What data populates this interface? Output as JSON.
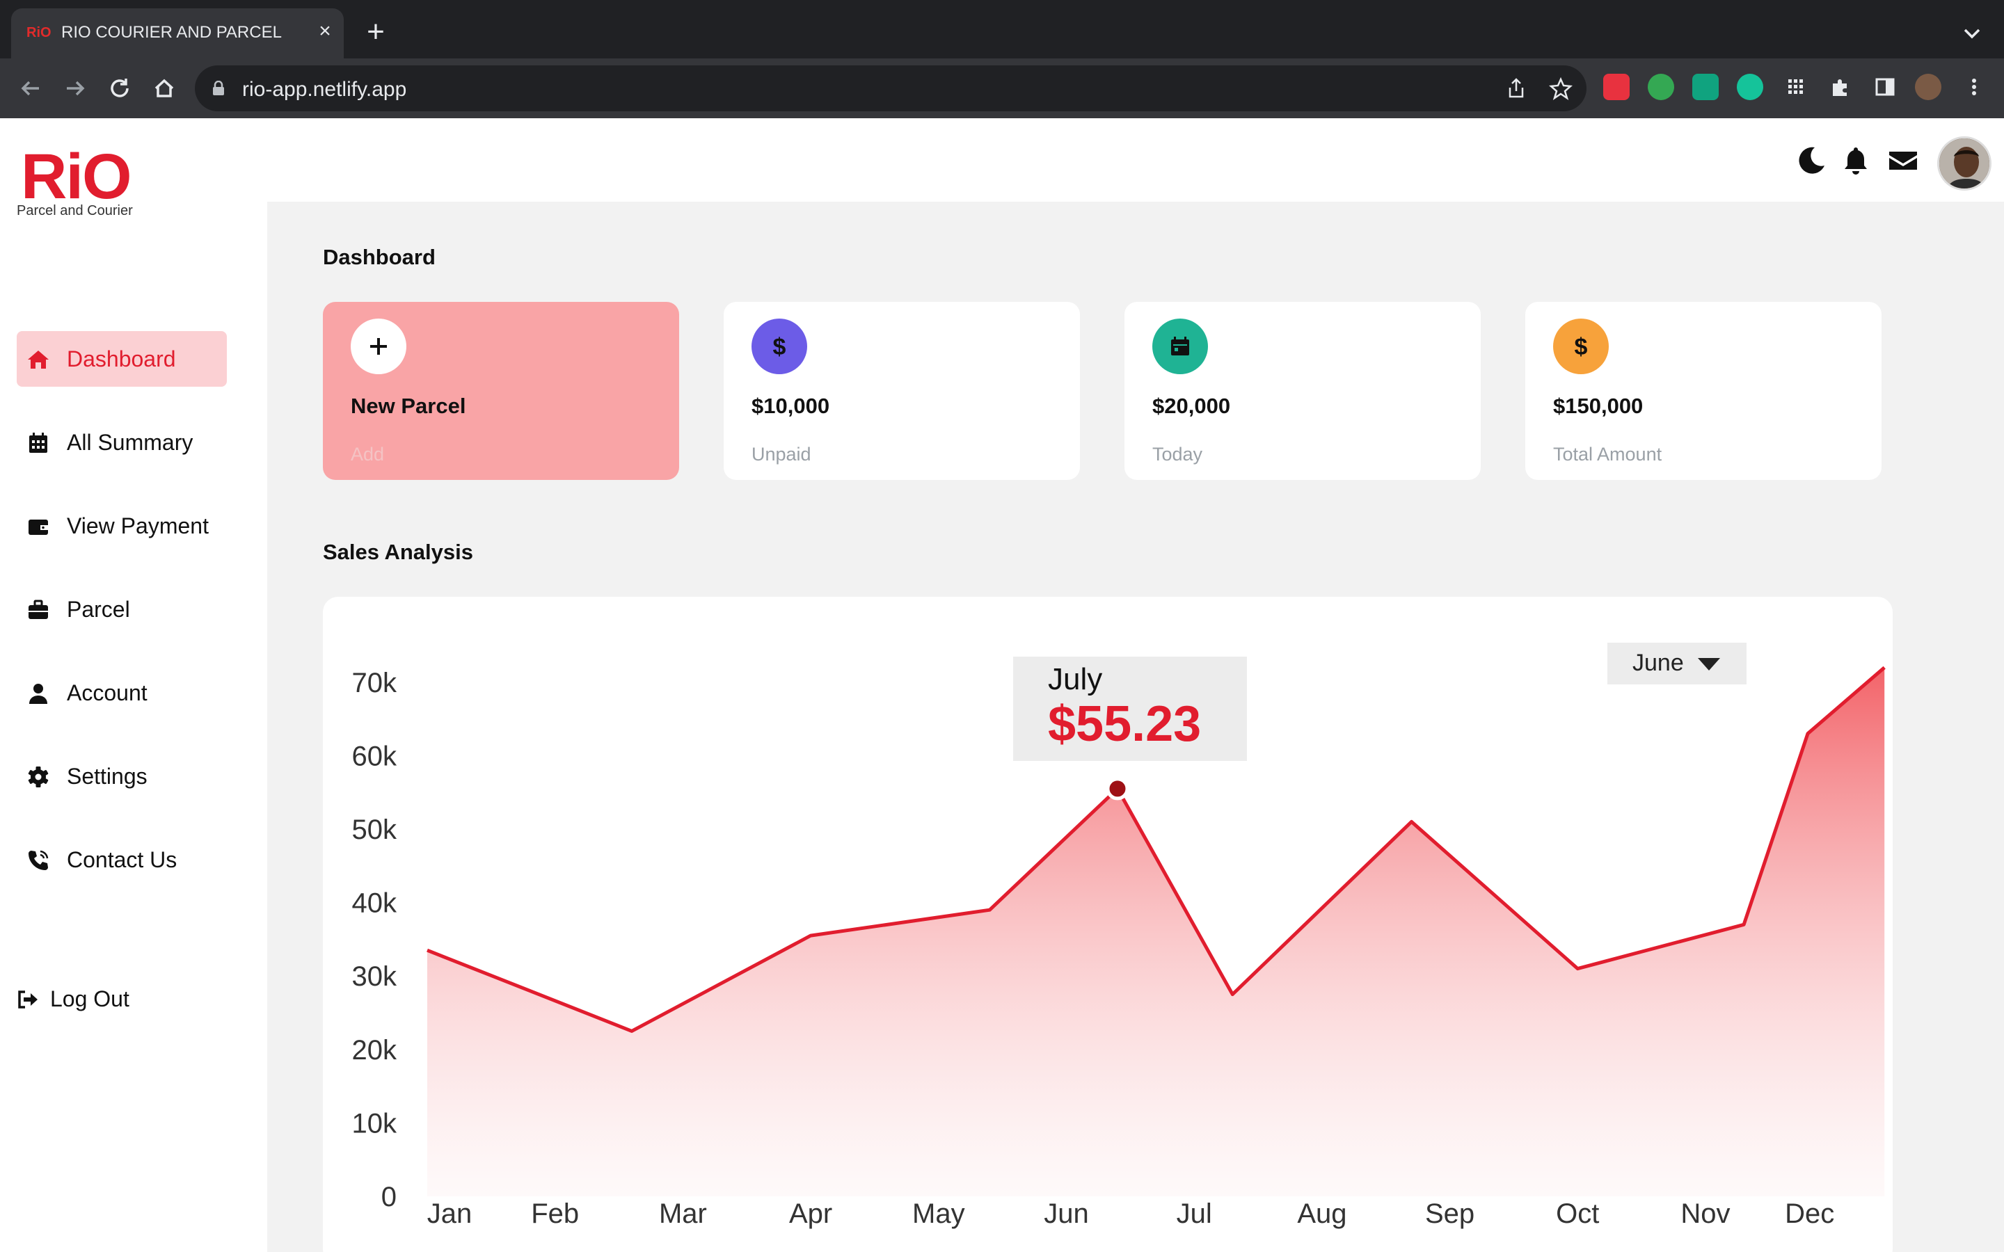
{
  "browser": {
    "tab_favicon": "RiO",
    "tab_title": "RIO COURIER AND PARCEL",
    "url": "rio-app.netlify.app"
  },
  "brand": {
    "logo": "RiO",
    "tagline": "Parcel and Courier",
    "accent_color": "#e11d2e"
  },
  "sidebar": {
    "items": [
      {
        "label": "Dashboard",
        "icon": "home-icon",
        "active": true
      },
      {
        "label": "All Summary",
        "icon": "calendar-grid-icon"
      },
      {
        "label": "View Payment",
        "icon": "wallet-icon"
      },
      {
        "label": "Parcel",
        "icon": "briefcase-icon"
      },
      {
        "label": "Account",
        "icon": "user-icon"
      },
      {
        "label": "Settings",
        "icon": "gear-icon"
      },
      {
        "label": "Contact Us",
        "icon": "phone-icon"
      }
    ],
    "logout": {
      "label": "Log Out",
      "icon": "sign-out-icon"
    }
  },
  "topbar": {
    "icons": [
      "moon-icon",
      "bell-icon",
      "envelope-icon",
      "avatar"
    ]
  },
  "dashboard": {
    "title": "Dashboard",
    "cards": [
      {
        "value": "New Parcel",
        "label": "Add",
        "icon": "plus-icon",
        "icon_color": "#ffffff"
      },
      {
        "value": "$10,000",
        "label": "Unpaid",
        "icon": "dollar-icon",
        "icon_color": "#6c5ce7"
      },
      {
        "value": "$20,000",
        "label": "Today",
        "icon": "calendar-icon",
        "icon_color": "#1fb394"
      },
      {
        "value": "$150,000",
        "label": "Total Amount",
        "icon": "dollar-icon",
        "icon_color": "#f7a23b"
      }
    ]
  },
  "sales": {
    "title": "Sales Analysis",
    "month_select": "June",
    "tooltip": {
      "month": "July",
      "value": "$55.23"
    }
  },
  "chart_data": {
    "type": "area",
    "categories": [
      "Jan",
      "Feb",
      "Mar",
      "Apr",
      "May",
      "Jun",
      "Jul",
      "Aug",
      "Sep",
      "Oct",
      "Nov",
      "Dec"
    ],
    "x": [
      "Jan",
      "Jun",
      "Jul",
      "Aug",
      "Sep",
      "Oct",
      "Nov",
      "Dec"
    ],
    "y_ticks": [
      "0",
      "10k",
      "20k",
      "30k",
      "40k",
      "50k",
      "60k",
      "70k"
    ],
    "ylim": [
      0,
      70000
    ],
    "series": [
      {
        "points": [
          {
            "x": 0,
            "y": 33500
          },
          {
            "x": 1.6,
            "y": 22500
          },
          {
            "x": 3.0,
            "y": 35500
          },
          {
            "x": 4.4,
            "y": 39000
          },
          {
            "x": 5.4,
            "y": 55500
          },
          {
            "x": 6.3,
            "y": 27500
          },
          {
            "x": 7.7,
            "y": 51000
          },
          {
            "x": 9.0,
            "y": 31000
          },
          {
            "x": 10.3,
            "y": 37000
          },
          {
            "x": 10.8,
            "y": 63000
          },
          {
            "x": 11.4,
            "y": 72000
          }
        ]
      }
    ],
    "highlight": {
      "x": 5.4,
      "y": 55500
    },
    "line_color": "#e11d2e",
    "fill_color": "#f36b70"
  }
}
